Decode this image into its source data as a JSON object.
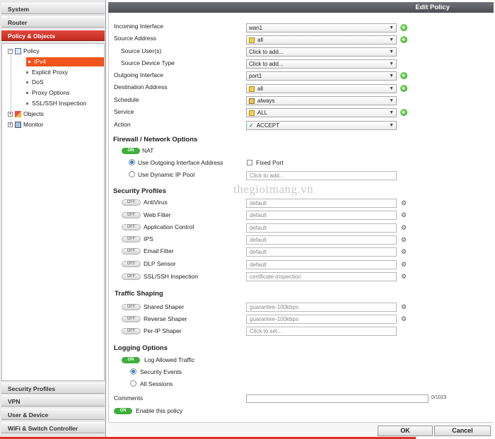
{
  "sidebar": {
    "headers_top": [
      "System",
      "Router",
      "Policy & Objects"
    ],
    "tree": {
      "policy": "Policy",
      "items": [
        "IPv4",
        "Explicit Proxy",
        "DoS",
        "Proxy Options",
        "SSL/SSH Inspection"
      ],
      "objects": "Objects",
      "monitor": "Monitor"
    },
    "headers_bottom": [
      "Security Profiles",
      "VPN",
      "User & Device",
      "WiFi & Switch Controller"
    ]
  },
  "panel": {
    "title": "Edit Policy"
  },
  "fields": [
    {
      "label": "Incoming Interface",
      "value": "wan1"
    },
    {
      "label": "Source Address",
      "value": "all"
    },
    {
      "label": "Source User(s)",
      "value": "Click to add..."
    },
    {
      "label": "Source Device Type",
      "value": "Click to add..."
    },
    {
      "label": "Outgoing Interface",
      "value": "port1"
    },
    {
      "label": "Destination Address",
      "value": "all"
    },
    {
      "label": "Schedule",
      "value": "always"
    },
    {
      "label": "Service",
      "value": "ALL"
    },
    {
      "label": "Action",
      "value": "ACCEPT"
    }
  ],
  "firewall": {
    "title": "Firewall / Network Options",
    "nat_state": "ON",
    "nat_label": "NAT",
    "use_outgoing": "Use Outgoing Interface Address",
    "fixed_port": "Fixed Port",
    "use_dynamic": "Use Dynamic IP Pool",
    "pool_placeholder": "Click to add..."
  },
  "security_profiles": {
    "title": "Security Profiles",
    "items": [
      {
        "state": "OFF",
        "label": "AntiVirus",
        "value": "default"
      },
      {
        "state": "OFF",
        "label": "Web Filter",
        "value": "default"
      },
      {
        "state": "OFF",
        "label": "Application Control",
        "value": "default"
      },
      {
        "state": "OFF",
        "label": "IPS",
        "value": "default"
      },
      {
        "state": "OFF",
        "label": "Email Filter",
        "value": "default"
      },
      {
        "state": "OFF",
        "label": "DLP Sensor",
        "value": "default"
      },
      {
        "state": "OFF",
        "label": "SSL/SSH Inspection",
        "value": "certificate-inspection"
      }
    ]
  },
  "traffic_shaping": {
    "title": "Traffic Shaping",
    "items": [
      {
        "state": "OFF",
        "label": "Shared Shaper",
        "value": "guarantee-100kbps"
      },
      {
        "state": "OFF",
        "label": "Reverse Shaper",
        "value": "guarantee-100kbps"
      },
      {
        "state": "OFF",
        "label": "Per-IP Shaper",
        "value": "Click to set..."
      }
    ]
  },
  "logging": {
    "title": "Logging Options",
    "log_state": "ON",
    "log_label": "Log Allowed Traffic",
    "security_events": "Security Events",
    "all_sessions": "All Sessions"
  },
  "comments": {
    "label": "Comments",
    "counter": "0/1023"
  },
  "enable": {
    "state": "ON",
    "label": "Enable this policy"
  },
  "watermark": "thegioimang.vn",
  "buttons": {
    "ok": "OK",
    "cancel": "Cancel"
  },
  "colors": {
    "accent": "#c22a1e",
    "toggle_on": "#3fae3c",
    "selection": "#f0541c"
  }
}
